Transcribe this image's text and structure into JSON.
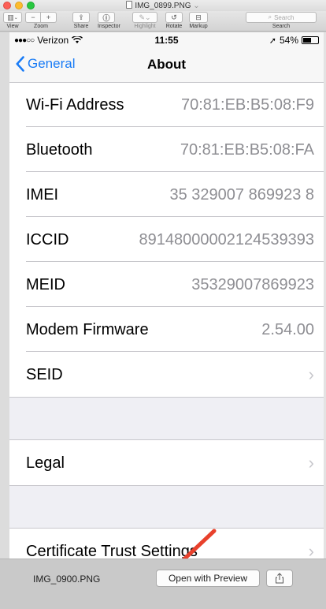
{
  "window": {
    "title": "IMG_0899.PNG",
    "title_chevron": "⌄"
  },
  "toolbar": {
    "view_label": "View",
    "zoom_label": "Zoom",
    "share_label": "Share",
    "inspector_label": "Inspector",
    "highlight_label": "Highlight",
    "rotate_label": "Rotate",
    "markup_label": "Markup",
    "search_placeholder": "Search",
    "search_label": "Search"
  },
  "statusbar": {
    "signal": "●●●○○",
    "carrier": "Verizon",
    "time": "11:55",
    "battery_text": "54%",
    "battery_level": 0.54
  },
  "navbar": {
    "back_label": "General",
    "title": "About"
  },
  "rows": [
    {
      "label": "Wi-Fi Address",
      "value": "70:81:EB:B5:08:F9"
    },
    {
      "label": "Bluetooth",
      "value": "70:81:EB:B5:08:FA"
    },
    {
      "label": "IMEI",
      "value": "35 329007 869923 8"
    },
    {
      "label": "ICCID",
      "value": "89148000002124539393"
    },
    {
      "label": "MEID",
      "value": "35329007869923"
    },
    {
      "label": "Modem Firmware",
      "value": "2.54.00"
    },
    {
      "label": "SEID",
      "chevron": "›"
    },
    {
      "label": "Legal",
      "chevron": "›"
    },
    {
      "label": "Certificate Trust Settings",
      "chevron": "›"
    }
  ],
  "annotation": {
    "arrow_color": "#e8412c"
  },
  "bottom": {
    "filename": "IMG_0900.PNG",
    "open_button": "Open with Preview"
  },
  "colors": {
    "ios_blue": "#1a7cf6",
    "separator": "#c8c7cc",
    "group_background": "#efeff4",
    "value_gray": "#8e8e93"
  }
}
